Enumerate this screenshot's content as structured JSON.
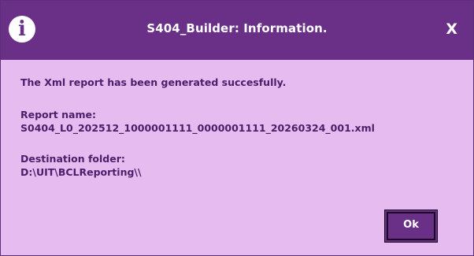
{
  "dialog": {
    "title": "S404_Builder: Information.",
    "close_label": "X",
    "info_icon_glyph": "i",
    "message": "The Xml report has been  generated succesfully.",
    "report_name_label": "Report name:",
    "report_name_value": "S0404_L0_202512_1000001111_0000001111_20260324_001.xml",
    "destination_label": "Destination folder:",
    "destination_value": "D:\\UIT\\BCLReporting\\\\",
    "ok_label": "Ok"
  },
  "colors": {
    "titlebar": "#6a3088",
    "body": "#e6bcf0",
    "text": "#4a1e6a",
    "button": "#6a3088"
  }
}
